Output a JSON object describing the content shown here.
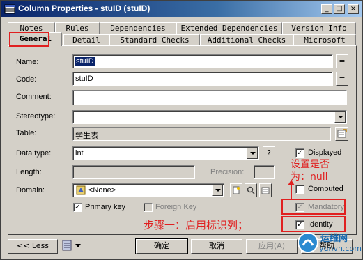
{
  "window": {
    "title": "Column Properties - stuID (stuID)",
    "controls": [
      "_",
      "□",
      "×"
    ]
  },
  "tabs": {
    "row1": [
      "Notes",
      "Rules",
      "Dependencies",
      "Extended Dependencies",
      "Version Info"
    ],
    "row2": [
      "General",
      "Detail",
      "Standard Checks",
      "Additional Checks",
      "Microsoft"
    ]
  },
  "form": {
    "name_label": "Name:",
    "name_value": "stuID",
    "code_label": "Code:",
    "code_value": "stuID",
    "comment_label": "Comment:",
    "comment_value": "",
    "stereotype_label": "Stereotype:",
    "stereotype_value": "",
    "table_label": "Table:",
    "table_value": "学生表",
    "datatype_label": "Data type:",
    "datatype_value": "int",
    "question_button": "?",
    "length_label": "Length:",
    "length_value": "",
    "precision_label": "Precision:",
    "precision_value": "",
    "domain_label": "Domain:",
    "domain_value": "<None>",
    "equals_button": "=",
    "primary_key_label": "Primary key",
    "primary_key_checked": true,
    "foreign_key_label": "Foreign Key",
    "foreign_key_checked": false
  },
  "options": {
    "displayed_label": "Displayed",
    "displayed_checked": true,
    "computed_label": "Computed",
    "computed_checked": false,
    "mandatory_label": "Mandatory",
    "mandatory_checked": true,
    "identity_label": "Identity",
    "identity_checked": true
  },
  "annotations": {
    "note1_line1": "设置是否",
    "note1_line2": "为：null",
    "step1": "步骤一：启用标识列；"
  },
  "buttons": {
    "less": "<< Less",
    "ok": "确定",
    "cancel": "取消",
    "apply": "应用(A)",
    "help": "帮助"
  },
  "watermark": {
    "text1": "运维网",
    "text2": "yunvn.com"
  },
  "colors": {
    "annotation_red": "#e02020",
    "title_bar": "#0a246a",
    "dialog_face": "#d4d0c8"
  }
}
